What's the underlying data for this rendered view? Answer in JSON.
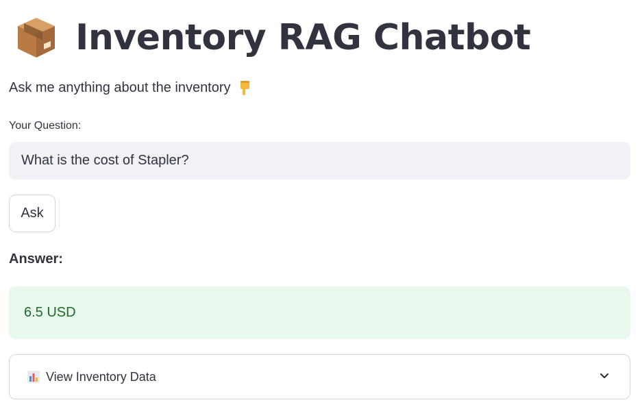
{
  "header": {
    "title": "Inventory RAG Chatbot",
    "icon": "package-box-icon"
  },
  "intro": {
    "text": "Ask me anything about the inventory",
    "icon": "pointing-down-hand-icon"
  },
  "question": {
    "label": "Your Question:",
    "value": "What is the cost of Stapler?",
    "placeholder": ""
  },
  "ask_button": {
    "label": "Ask"
  },
  "answer": {
    "label": "Answer:",
    "value": "6.5 USD"
  },
  "expander": {
    "label": "View Inventory Data",
    "icon": "bar-chart-icon",
    "chevron": "chevron-down-icon"
  },
  "colors": {
    "text": "#31333f",
    "input_bg": "#f0f2f6",
    "success_bg": "#e9f8ec",
    "success_text": "#1d6a2b",
    "border": "#d5d6db"
  }
}
